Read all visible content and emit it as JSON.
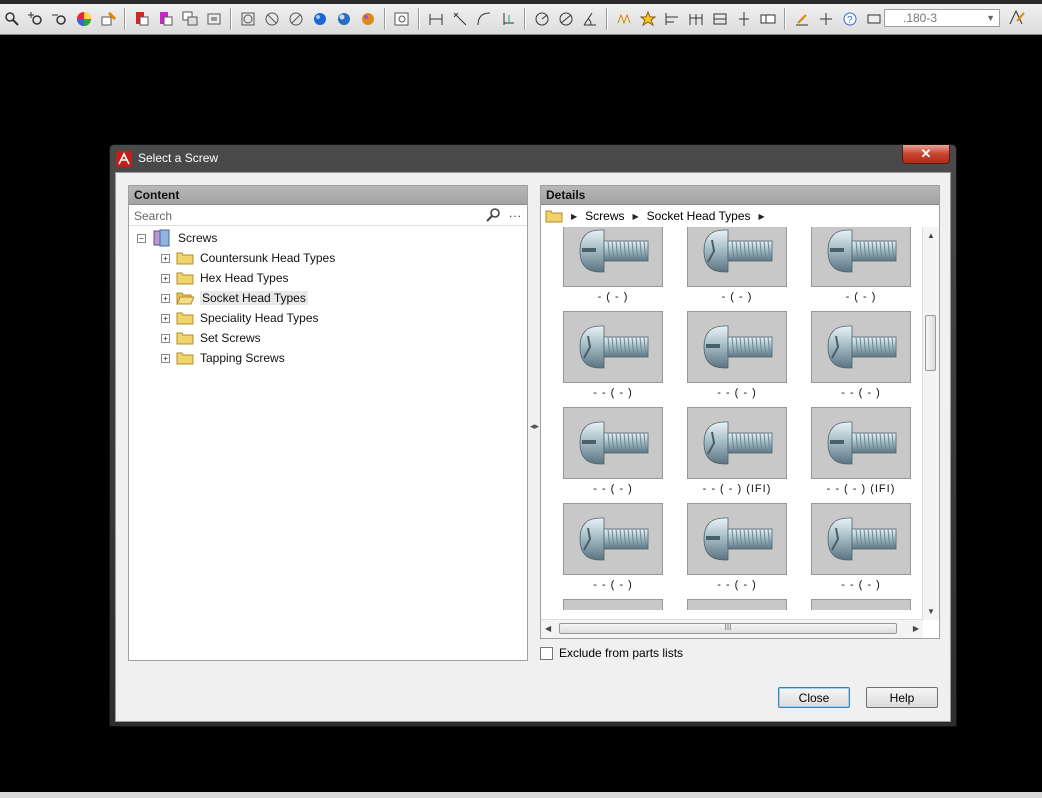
{
  "toolbar": {
    "layer_value": ".180-3"
  },
  "dialog": {
    "title": "Select a Screw",
    "content_header": "Content",
    "details_header": "Details",
    "search_placeholder": "Search",
    "more_label": "...",
    "tree": {
      "root": "Screws",
      "children": [
        {
          "label": "Countersunk Head Types",
          "selected": false
        },
        {
          "label": "Hex Head Types",
          "selected": false
        },
        {
          "label": "Socket Head Types",
          "selected": true
        },
        {
          "label": "Speciality Head Types",
          "selected": false
        },
        {
          "label": "Set Screws",
          "selected": false
        },
        {
          "label": "Tapping Screws",
          "selected": false
        }
      ]
    },
    "breadcrumb": [
      "Screws",
      "Socket Head Types"
    ],
    "tiles": [
      {
        "caption": "- ( - )"
      },
      {
        "caption": "- ( - )"
      },
      {
        "caption": "- ( - )"
      },
      {
        "caption": "- - ( - )"
      },
      {
        "caption": "- - ( - )"
      },
      {
        "caption": "- - ( - )"
      },
      {
        "caption": "- - ( - )"
      },
      {
        "caption": "- - ( - ) (IFI)"
      },
      {
        "caption": "- - ( - ) (IFI)"
      },
      {
        "caption": "- - ( - )"
      },
      {
        "caption": "- - ( - )"
      },
      {
        "caption": "- - ( - )"
      }
    ],
    "exclude_label": "Exclude from parts lists",
    "exclude_checked": false,
    "close_button": "Close",
    "help_button": "Help",
    "hscroll_grip": "III"
  }
}
